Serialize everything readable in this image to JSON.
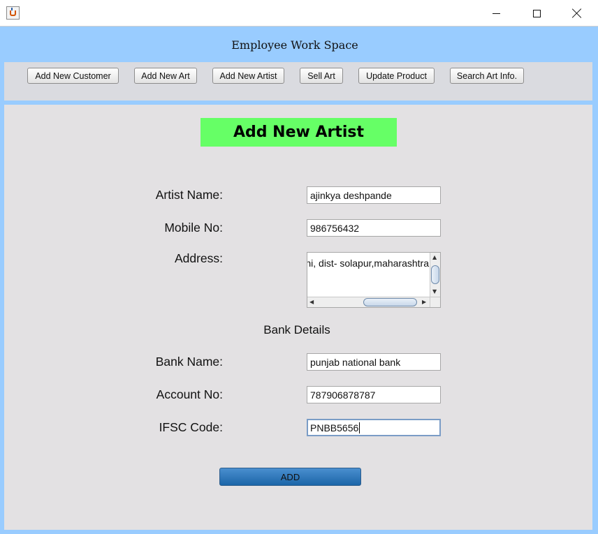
{
  "window": {
    "icon": "java-cup-icon",
    "controls": {
      "minimize": "minimize-icon",
      "maximize": "maximize-icon",
      "close": "close-icon"
    }
  },
  "header": {
    "title": "Employee Work Space"
  },
  "toolbar": {
    "buttons": [
      {
        "label": "Add New Customer"
      },
      {
        "label": "Add New Art"
      },
      {
        "label": "Add New Artist"
      },
      {
        "label": "Sell Art"
      },
      {
        "label": "Update Product"
      },
      {
        "label": "Search Art Info."
      }
    ]
  },
  "form": {
    "title": "Add New Artist",
    "artist_name": {
      "label": "Artist Name:",
      "value": "ajinkya deshpande"
    },
    "mobile": {
      "label": "Mobile No:",
      "value": "986756432"
    },
    "address": {
      "label": "Address:",
      "value": "hi, dist- solapur,maharashtra"
    },
    "bank_section": "Bank Details",
    "bank_name": {
      "label": "Bank Name:",
      "value": "punjab national bank"
    },
    "account_no": {
      "label": "Account No:",
      "value": "787906878787"
    },
    "ifsc": {
      "label": "IFSC Code:",
      "value": "PNBB5656"
    },
    "submit_label": "ADD"
  },
  "colors": {
    "frame": "#99ccff",
    "panel": "#e3e1e3",
    "title_highlight": "#66ff66",
    "add_button": "#1b65a8"
  }
}
